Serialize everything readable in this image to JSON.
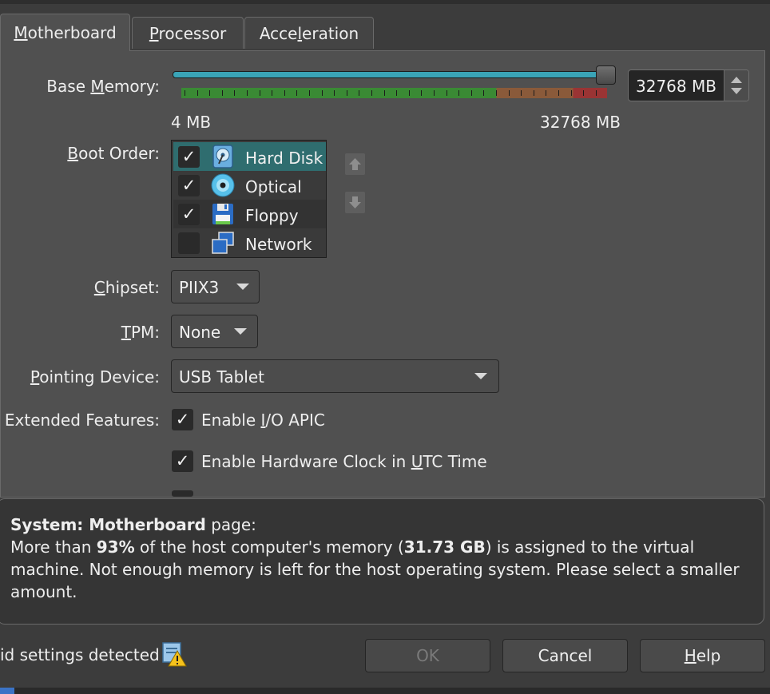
{
  "tabs": [
    {
      "pre": "",
      "ul": "M",
      "post": "otherboard"
    },
    {
      "pre": "",
      "ul": "P",
      "post": "rocessor"
    },
    {
      "pre": "Acce",
      "ul": "l",
      "post": "eration"
    }
  ],
  "base_memory": {
    "label_pre": "Base ",
    "label_ul": "M",
    "label_post": "emory:",
    "min_label": "4 MB",
    "max_label": "32768 MB",
    "value": "32768 MB",
    "slider_fraction": 1.0
  },
  "boot_order": {
    "label_ul": "B",
    "label_post": "oot Order:",
    "items": [
      {
        "label": "Hard Disk",
        "checked": true,
        "icon": "hard-disk-icon"
      },
      {
        "label": "Optical",
        "checked": true,
        "icon": "optical-disc-icon"
      },
      {
        "label": "Floppy",
        "checked": true,
        "icon": "floppy-icon"
      },
      {
        "label": "Network",
        "checked": false,
        "icon": "network-icon"
      }
    ],
    "move_up_icon": "arrow-up-icon",
    "move_down_icon": "arrow-down-icon"
  },
  "chipset": {
    "label_ul": "C",
    "label_post": "hipset:",
    "value": "PIIX3"
  },
  "tpm": {
    "label_ul": "T",
    "label_post": "PM:",
    "value": "None"
  },
  "pointing_device": {
    "label_ul": "P",
    "label_post": "ointing Device:",
    "value": "USB Tablet"
  },
  "extended_features": {
    "label": "Extended Features:",
    "io_apic": {
      "pre": "Enable ",
      "ul": "I",
      "post": "/O APIC",
      "checked": true
    },
    "utc": {
      "pre": "Enable Hardware Clock in ",
      "ul": "U",
      "post": "TC Time",
      "checked": true
    }
  },
  "info": {
    "title_bold": "System: Motherboard",
    "title_rest": " page:",
    "msg_1": "More than ",
    "msg_pct": "93%",
    "msg_2": " of the host computer's memory (",
    "msg_gb": "31.73 GB",
    "msg_3": ") is assigned to the virtual machine. Not enough memory is left for the host operating system. Please select a smaller amount."
  },
  "status": {
    "text": "id settings detected",
    "icon": "warning-icon"
  },
  "buttons": {
    "ok": "OK",
    "cancel": "Cancel",
    "help_ul": "H",
    "help_post": "elp"
  },
  "colors": {
    "selection": "#2f6d6f",
    "slider": "#3aa4b7"
  }
}
